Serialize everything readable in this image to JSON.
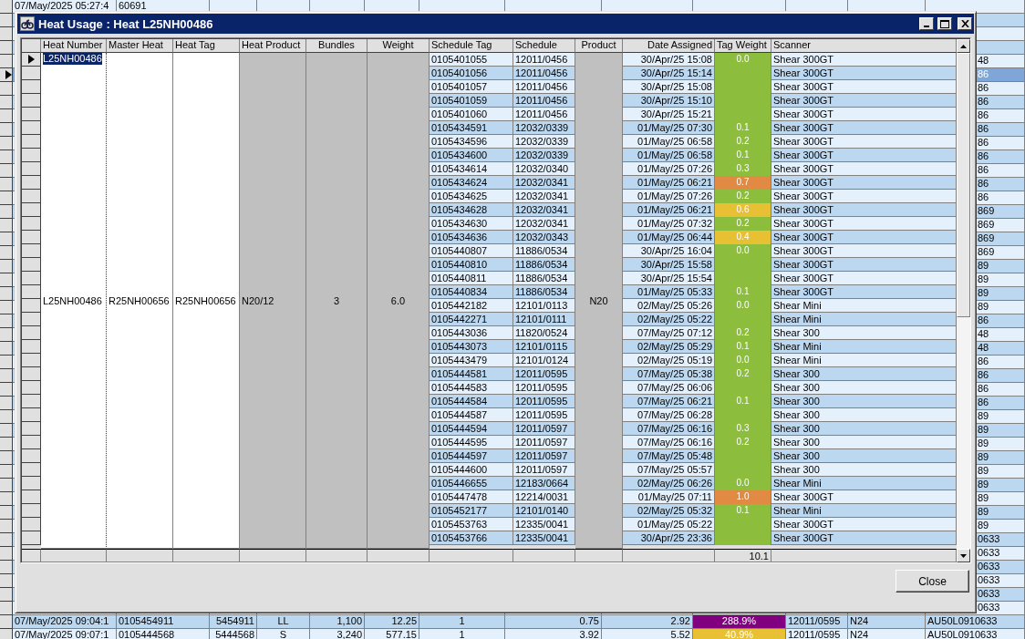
{
  "background_grid": {
    "rows": [
      {
        "kind": "full",
        "selected": false,
        "cells": [
          "07/May/2025 05:27:4",
          "60691"
        ]
      },
      {
        "kind": "blank",
        "selected": false
      },
      {
        "kind": "blank",
        "selected": false
      },
      {
        "kind": "blank",
        "selected": false
      },
      {
        "kind": "tail",
        "selected": false,
        "cells": [
          "48"
        ]
      },
      {
        "kind": "tail",
        "selected": true,
        "cells": [
          "86"
        ]
      },
      {
        "kind": "tail",
        "selected": false,
        "cells": [
          "86"
        ]
      },
      {
        "kind": "tail",
        "selected": false,
        "cells": [
          "86"
        ]
      },
      {
        "kind": "tail",
        "selected": false,
        "cells": [
          "86"
        ]
      },
      {
        "kind": "tail",
        "selected": false,
        "cells": [
          "86"
        ]
      },
      {
        "kind": "tail",
        "selected": false,
        "cells": [
          "86"
        ]
      },
      {
        "kind": "tail",
        "selected": false,
        "cells": [
          "86"
        ]
      },
      {
        "kind": "tail",
        "selected": false,
        "cells": [
          "86"
        ]
      },
      {
        "kind": "tail",
        "selected": false,
        "cells": [
          "86"
        ]
      },
      {
        "kind": "tail",
        "selected": false,
        "cells": [
          "86"
        ]
      },
      {
        "kind": "tail",
        "selected": false,
        "cells": [
          "869"
        ]
      },
      {
        "kind": "tail",
        "selected": false,
        "cells": [
          "869"
        ]
      },
      {
        "kind": "tail",
        "selected": false,
        "cells": [
          "869"
        ]
      },
      {
        "kind": "tail",
        "selected": false,
        "cells": [
          "869"
        ]
      },
      {
        "kind": "tail",
        "selected": false,
        "cells": [
          "89"
        ]
      },
      {
        "kind": "tail",
        "selected": false,
        "cells": [
          "89"
        ]
      },
      {
        "kind": "tail",
        "selected": false,
        "cells": [
          "89"
        ]
      },
      {
        "kind": "tail",
        "selected": false,
        "cells": [
          "89"
        ]
      },
      {
        "kind": "tail",
        "selected": false,
        "cells": [
          "86"
        ]
      },
      {
        "kind": "tail",
        "selected": false,
        "cells": [
          "48"
        ]
      },
      {
        "kind": "tail",
        "selected": false,
        "cells": [
          "48"
        ]
      },
      {
        "kind": "tail",
        "selected": false,
        "cells": [
          "86"
        ]
      },
      {
        "kind": "tail",
        "selected": false,
        "cells": [
          "86"
        ]
      },
      {
        "kind": "tail",
        "selected": false,
        "cells": [
          "86"
        ]
      },
      {
        "kind": "tail",
        "selected": false,
        "cells": [
          "86"
        ]
      },
      {
        "kind": "tail",
        "selected": false,
        "cells": [
          "89"
        ]
      },
      {
        "kind": "tail",
        "selected": false,
        "cells": [
          "89"
        ]
      },
      {
        "kind": "tail",
        "selected": false,
        "cells": [
          "89"
        ]
      },
      {
        "kind": "tail",
        "selected": false,
        "cells": [
          "89"
        ]
      },
      {
        "kind": "tail",
        "selected": false,
        "cells": [
          "89"
        ]
      },
      {
        "kind": "tail",
        "selected": false,
        "cells": [
          "89"
        ]
      },
      {
        "kind": "tail",
        "selected": false,
        "cells": [
          "89"
        ]
      },
      {
        "kind": "tail",
        "selected": false,
        "cells": [
          "89"
        ]
      },
      {
        "kind": "tail",
        "selected": false,
        "cells": [
          "89"
        ]
      },
      {
        "kind": "tail",
        "selected": false,
        "cells": [
          "0633"
        ]
      },
      {
        "kind": "tail",
        "selected": false,
        "cells": [
          "0633"
        ]
      },
      {
        "kind": "tail",
        "selected": false,
        "cells": [
          "0633"
        ]
      },
      {
        "kind": "tail",
        "selected": false,
        "cells": [
          "0633"
        ]
      },
      {
        "kind": "tail",
        "selected": false,
        "cells": [
          "0633"
        ]
      },
      {
        "kind": "tail",
        "selected": false,
        "cells": [
          "0633"
        ]
      },
      {
        "kind": "full",
        "selected": false,
        "color": "#800080",
        "cells": [
          "07/May/2025 09:04:1",
          "0105454911",
          "5454911",
          "LL",
          "1,100",
          "12.25",
          "1",
          "0.75",
          "2.92",
          "288.9%",
          "12011/0595",
          "N24",
          "AU50L0910633"
        ]
      },
      {
        "kind": "full",
        "selected": false,
        "color": "#e8c034",
        "cells": [
          "07/May/2025 09:07:1",
          "0105444568",
          "5444568",
          "S",
          "3,240",
          "577.15",
          "1",
          "3.92",
          "5.52",
          "40.9%",
          "12011/0595",
          "N24",
          "AU50L0910633"
        ]
      }
    ]
  },
  "dialog": {
    "title": "Heat Usage : Heat L25NH00486",
    "heat_grid": {
      "columns": [
        "Heat Number",
        "Master Heat",
        "Heat Tag",
        "Heat Product",
        "Bundles",
        "Weight",
        "Schedule Tag",
        "Schedule",
        "Product",
        "Date Assigned",
        "Tag Weight",
        "Scanner"
      ],
      "heat": {
        "editor_value": "L25NH00486",
        "heat_number": "L25NH00486",
        "master_heat": "R25NH00656",
        "heat_tag": "R25NH00656",
        "heat_product": "N20/12",
        "bundles": "3",
        "weight": "6.0",
        "product": "N20"
      },
      "rows": [
        {
          "selected": true,
          "schedule_tag": "0105401055",
          "schedule": "12011/0456",
          "date_assigned": "30/Apr/25 15:08",
          "tag_weight": "0.0",
          "color": "#8dbd3c",
          "scanner": "Shear 300GT"
        },
        {
          "selected": false,
          "schedule_tag": "0105401056",
          "schedule": "12011/0456",
          "date_assigned": "30/Apr/25 15:14",
          "color": "#8dbd3c",
          "scanner": "Shear 300GT"
        },
        {
          "selected": false,
          "schedule_tag": "0105401057",
          "schedule": "12011/0456",
          "date_assigned": "30/Apr/25 15:08",
          "color": "#8dbd3c",
          "scanner": "Shear 300GT"
        },
        {
          "selected": false,
          "schedule_tag": "0105401059",
          "schedule": "12011/0456",
          "date_assigned": "30/Apr/25 15:10",
          "color": "#8dbd3c",
          "scanner": "Shear 300GT"
        },
        {
          "selected": false,
          "schedule_tag": "0105401060",
          "schedule": "12011/0456",
          "date_assigned": "30/Apr/25 15:21",
          "color": "#8dbd3c",
          "scanner": "Shear 300GT"
        },
        {
          "selected": false,
          "schedule_tag": "0105434591",
          "schedule": "12032/0339",
          "date_assigned": "01/May/25 07:30",
          "tag_weight": "0.1",
          "color": "#8dbd3c",
          "scanner": "Shear 300GT"
        },
        {
          "selected": false,
          "schedule_tag": "0105434596",
          "schedule": "12032/0339",
          "date_assigned": "01/May/25 06:58",
          "tag_weight": "0.2",
          "color": "#8dbd3c",
          "scanner": "Shear 300GT"
        },
        {
          "selected": false,
          "schedule_tag": "0105434600",
          "schedule": "12032/0339",
          "date_assigned": "01/May/25 06:58",
          "tag_weight": "0.1",
          "color": "#8dbd3c",
          "scanner": "Shear 300GT"
        },
        {
          "selected": false,
          "schedule_tag": "0105434614",
          "schedule": "12032/0340",
          "date_assigned": "01/May/25 07:26",
          "tag_weight": "0.3",
          "color": "#8dbd3c",
          "scanner": "Shear 300GT"
        },
        {
          "selected": false,
          "schedule_tag": "0105434624",
          "schedule": "12032/0341",
          "date_assigned": "01/May/25 06:21",
          "tag_weight": "0.7",
          "color": "#e08a44",
          "scanner": "Shear 300GT"
        },
        {
          "selected": false,
          "schedule_tag": "0105434625",
          "schedule": "12032/0341",
          "date_assigned": "01/May/25 07:26",
          "tag_weight": "0.2",
          "color": "#8dbd3c",
          "scanner": "Shear 300GT"
        },
        {
          "selected": false,
          "schedule_tag": "0105434628",
          "schedule": "12032/0341",
          "date_assigned": "01/May/25 06:21",
          "tag_weight": "0.6",
          "color": "#e8c034",
          "scanner": "Shear 300GT"
        },
        {
          "selected": false,
          "schedule_tag": "0105434630",
          "schedule": "12032/0341",
          "date_assigned": "01/May/25 07:32",
          "tag_weight": "0.2",
          "color": "#8dbd3c",
          "scanner": "Shear 300GT"
        },
        {
          "selected": false,
          "schedule_tag": "0105434636",
          "schedule": "12032/0343",
          "date_assigned": "01/May/25 06:44",
          "tag_weight": "0.4",
          "color": "#e8c034",
          "scanner": "Shear 300GT"
        },
        {
          "selected": false,
          "schedule_tag": "0105440807",
          "schedule": "11886/0534",
          "date_assigned": "30/Apr/25 16:04",
          "tag_weight": "0.0",
          "color": "#8dbd3c",
          "scanner": "Shear 300GT"
        },
        {
          "selected": false,
          "schedule_tag": "0105440810",
          "schedule": "11886/0534",
          "date_assigned": "30/Apr/25 15:58",
          "color": "#8dbd3c",
          "scanner": "Shear 300GT"
        },
        {
          "selected": false,
          "schedule_tag": "0105440811",
          "schedule": "11886/0534",
          "date_assigned": "30/Apr/25 15:54",
          "color": "#8dbd3c",
          "scanner": "Shear 300GT"
        },
        {
          "selected": false,
          "schedule_tag": "0105440834",
          "schedule": "11886/0534",
          "date_assigned": "01/May/25 05:33",
          "tag_weight": "0.1",
          "color": "#8dbd3c",
          "scanner": "Shear 300GT"
        },
        {
          "selected": false,
          "schedule_tag": "0105442182",
          "schedule": "12101/0113",
          "date_assigned": "02/May/25 05:26",
          "tag_weight": "0.0",
          "color": "#8dbd3c",
          "scanner": "Shear Mini"
        },
        {
          "selected": false,
          "schedule_tag": "0105442271",
          "schedule": "12101/0111",
          "date_assigned": "02/May/25 05:22",
          "color": "#8dbd3c",
          "scanner": "Shear Mini"
        },
        {
          "selected": false,
          "schedule_tag": "0105443036",
          "schedule": "11820/0524",
          "date_assigned": "07/May/25 07:12",
          "tag_weight": "0.2",
          "color": "#8dbd3c",
          "scanner": "Shear 300"
        },
        {
          "selected": false,
          "schedule_tag": "0105443073",
          "schedule": "12101/0115",
          "date_assigned": "02/May/25 05:29",
          "tag_weight": "0.1",
          "color": "#8dbd3c",
          "scanner": "Shear Mini"
        },
        {
          "selected": false,
          "schedule_tag": "0105443479",
          "schedule": "12101/0124",
          "date_assigned": "02/May/25 05:19",
          "tag_weight": "0.0",
          "color": "#8dbd3c",
          "scanner": "Shear Mini"
        },
        {
          "selected": false,
          "schedule_tag": "0105444581",
          "schedule": "12011/0595",
          "date_assigned": "07/May/25 05:38",
          "tag_weight": "0.2",
          "color": "#8dbd3c",
          "scanner": "Shear 300"
        },
        {
          "selected": false,
          "schedule_tag": "0105444583",
          "schedule": "12011/0595",
          "date_assigned": "07/May/25 06:06",
          "color": "#8dbd3c",
          "scanner": "Shear 300"
        },
        {
          "selected": false,
          "schedule_tag": "0105444584",
          "schedule": "12011/0595",
          "date_assigned": "07/May/25 06:21",
          "tag_weight": "0.1",
          "color": "#8dbd3c",
          "scanner": "Shear 300"
        },
        {
          "selected": false,
          "schedule_tag": "0105444587",
          "schedule": "12011/0595",
          "date_assigned": "07/May/25 06:28",
          "color": "#8dbd3c",
          "scanner": "Shear 300"
        },
        {
          "selected": false,
          "schedule_tag": "0105444594",
          "schedule": "12011/0597",
          "date_assigned": "07/May/25 06:16",
          "tag_weight": "0.3",
          "color": "#8dbd3c",
          "scanner": "Shear 300"
        },
        {
          "selected": false,
          "schedule_tag": "0105444595",
          "schedule": "12011/0597",
          "date_assigned": "07/May/25 06:16",
          "tag_weight": "0.2",
          "color": "#8dbd3c",
          "scanner": "Shear 300"
        },
        {
          "selected": false,
          "schedule_tag": "0105444597",
          "schedule": "12011/0597",
          "date_assigned": "07/May/25 05:48",
          "color": "#8dbd3c",
          "scanner": "Shear 300"
        },
        {
          "selected": false,
          "schedule_tag": "0105444600",
          "schedule": "12011/0597",
          "date_assigned": "07/May/25 05:57",
          "color": "#8dbd3c",
          "scanner": "Shear 300"
        },
        {
          "selected": false,
          "schedule_tag": "0105446655",
          "schedule": "12183/0664",
          "date_assigned": "02/May/25 06:26",
          "tag_weight": "0.0",
          "color": "#8dbd3c",
          "scanner": "Shear Mini"
        },
        {
          "selected": false,
          "schedule_tag": "0105447478",
          "schedule": "12214/0031",
          "date_assigned": "01/May/25 07:11",
          "tag_weight": "1.0",
          "color": "#e08a44",
          "scanner": "Shear 300GT"
        },
        {
          "selected": false,
          "schedule_tag": "0105452177",
          "schedule": "12101/0140",
          "date_assigned": "02/May/25 05:32",
          "tag_weight": "0.1",
          "color": "#8dbd3c",
          "scanner": "Shear Mini"
        },
        {
          "selected": false,
          "schedule_tag": "0105453763",
          "schedule": "12335/0041",
          "date_assigned": "01/May/25 05:22",
          "color": "#8dbd3c",
          "scanner": "Shear 300GT"
        },
        {
          "selected": false,
          "schedule_tag": "0105453766",
          "schedule": "12335/0041",
          "date_assigned": "30/Apr/25 23:36",
          "color": "#8dbd3c",
          "scanner": "Shear 300GT"
        }
      ],
      "total_tag_weight": "10.1"
    },
    "buttons": [
      "Close"
    ]
  }
}
